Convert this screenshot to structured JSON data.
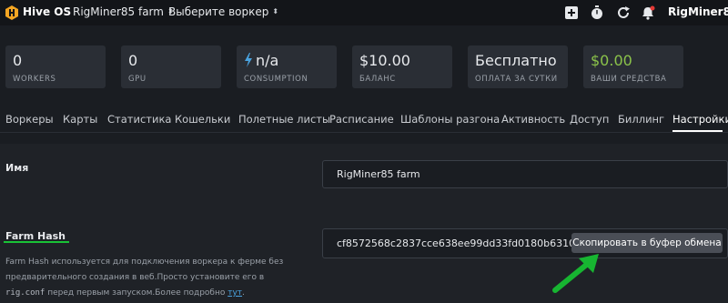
{
  "topbar": {
    "brand": "Hive OS",
    "farm_selector": "RigMiner85 farm",
    "worker_selector": "Выберите воркер",
    "user": "RigMiner85",
    "icons": [
      "plus-icon",
      "stopwatch-icon",
      "refresh-icon",
      "bell-icon"
    ]
  },
  "stats": [
    {
      "value": "0",
      "label": "WORKERS"
    },
    {
      "value": "0",
      "label": "GPU"
    },
    {
      "value": "n/a",
      "label": "CONSUMPTION"
    },
    {
      "value": "$10.00",
      "label": "БАЛАНС"
    },
    {
      "value": "Бесплатно",
      "label": "ОПЛАТА ЗА СУТКИ"
    },
    {
      "value": "$0.00",
      "label": "ВАШИ СРЕДСТВА"
    }
  ],
  "colors": {
    "accent_green": "#8bc34a",
    "underline_green": "#19c236",
    "arrow_green": "#17b531",
    "link_blue": "#4aa3df"
  },
  "tabs": [
    "Воркеры",
    "Карты",
    "Статистика",
    "Кошельки",
    "Полетные листы",
    "Расписание",
    "Шаблоны разгона",
    "Активность",
    "Доступ",
    "Биллинг",
    "Настройки"
  ],
  "active_tab": "Настройки",
  "settings": {
    "name_label": "Имя",
    "name_value": "RigMiner85 farm",
    "hash_label": "Farm Hash",
    "hash_value": "cf8572568c2837cce638ee99dd33fd0180b63101",
    "copy_button": "Скопировать в буфер обмена",
    "help_part1": "Farm Hash используется для подключения воркера к ферме без предварительного создания в веб.Просто установите его в",
    "help_code": "rig.conf",
    "help_part2": " перед первым запуском.Более подробно ",
    "help_link": "тут",
    "help_end": "."
  }
}
